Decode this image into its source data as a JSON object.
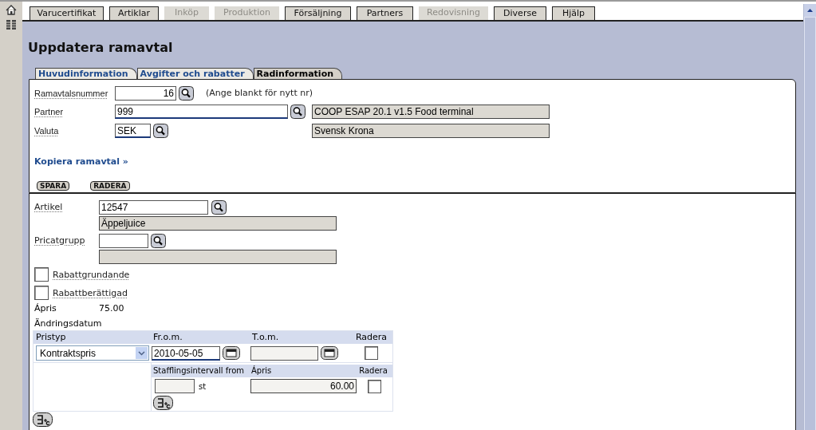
{
  "menu": [
    {
      "label": "Varucertifikat",
      "disabled": false
    },
    {
      "label": "Artiklar",
      "disabled": false
    },
    {
      "label": "Inköp",
      "disabled": true
    },
    {
      "label": "Produktion",
      "disabled": true
    },
    {
      "label": "Försäljning",
      "disabled": false
    },
    {
      "label": "Partners",
      "disabled": false
    },
    {
      "label": "Redovisning",
      "disabled": true
    },
    {
      "label": "Diverse",
      "disabled": false
    },
    {
      "label": "Hjälp",
      "disabled": false
    }
  ],
  "title": "Uppdatera ramavtal",
  "form_tabs": [
    {
      "label": "Huvudinformation",
      "selected": false
    },
    {
      "label": "Avgifter och rabatter",
      "selected": false
    },
    {
      "label": "Radinformation",
      "selected": true
    }
  ],
  "header": {
    "ramavtalsnummer": {
      "label": "Ramavtalsnummer",
      "value": "16",
      "hint": "(Ange blankt för nytt nr)"
    },
    "partner": {
      "label": "Partner",
      "value": "999",
      "name": "COOP ESAP 20.1 v1.5 Food terminal"
    },
    "valuta": {
      "label": "Valuta",
      "value": "SEK",
      "name": "Svensk Krona"
    },
    "copy_link": "Kopiera ramavtal »",
    "buttons": [
      "SPARA",
      "RADERA"
    ]
  },
  "row": {
    "artikel": {
      "label": "Artikel",
      "value": "12547",
      "name": "Äppeljuice"
    },
    "pricatgrupp": {
      "label": "Pricatgrupp"
    },
    "checkboxes": [
      {
        "label": "Rabattgrundande",
        "checked": false
      },
      {
        "label": "Rabattberättigad",
        "checked": false
      }
    ],
    "apris": {
      "label": "Ápris",
      "value": "75.00"
    },
    "andringsdatum": {
      "label": "Ändringsdatum"
    },
    "price_table": {
      "columns": [
        "Pristyp",
        "Fr.o.m.",
        "T.o.m.",
        "Radera"
      ],
      "rows": [
        {
          "pristyp": "Kontraktspris",
          "from": "2010-05-05",
          "delete": false,
          "tiers": {
            "columns": [
              "Stafflingsintervall from",
              "Ápris",
              "Radera"
            ],
            "rows": [
              {
                "unit": "st",
                "apris": "60.00",
                "delete": false
              }
            ]
          }
        }
      ]
    }
  }
}
